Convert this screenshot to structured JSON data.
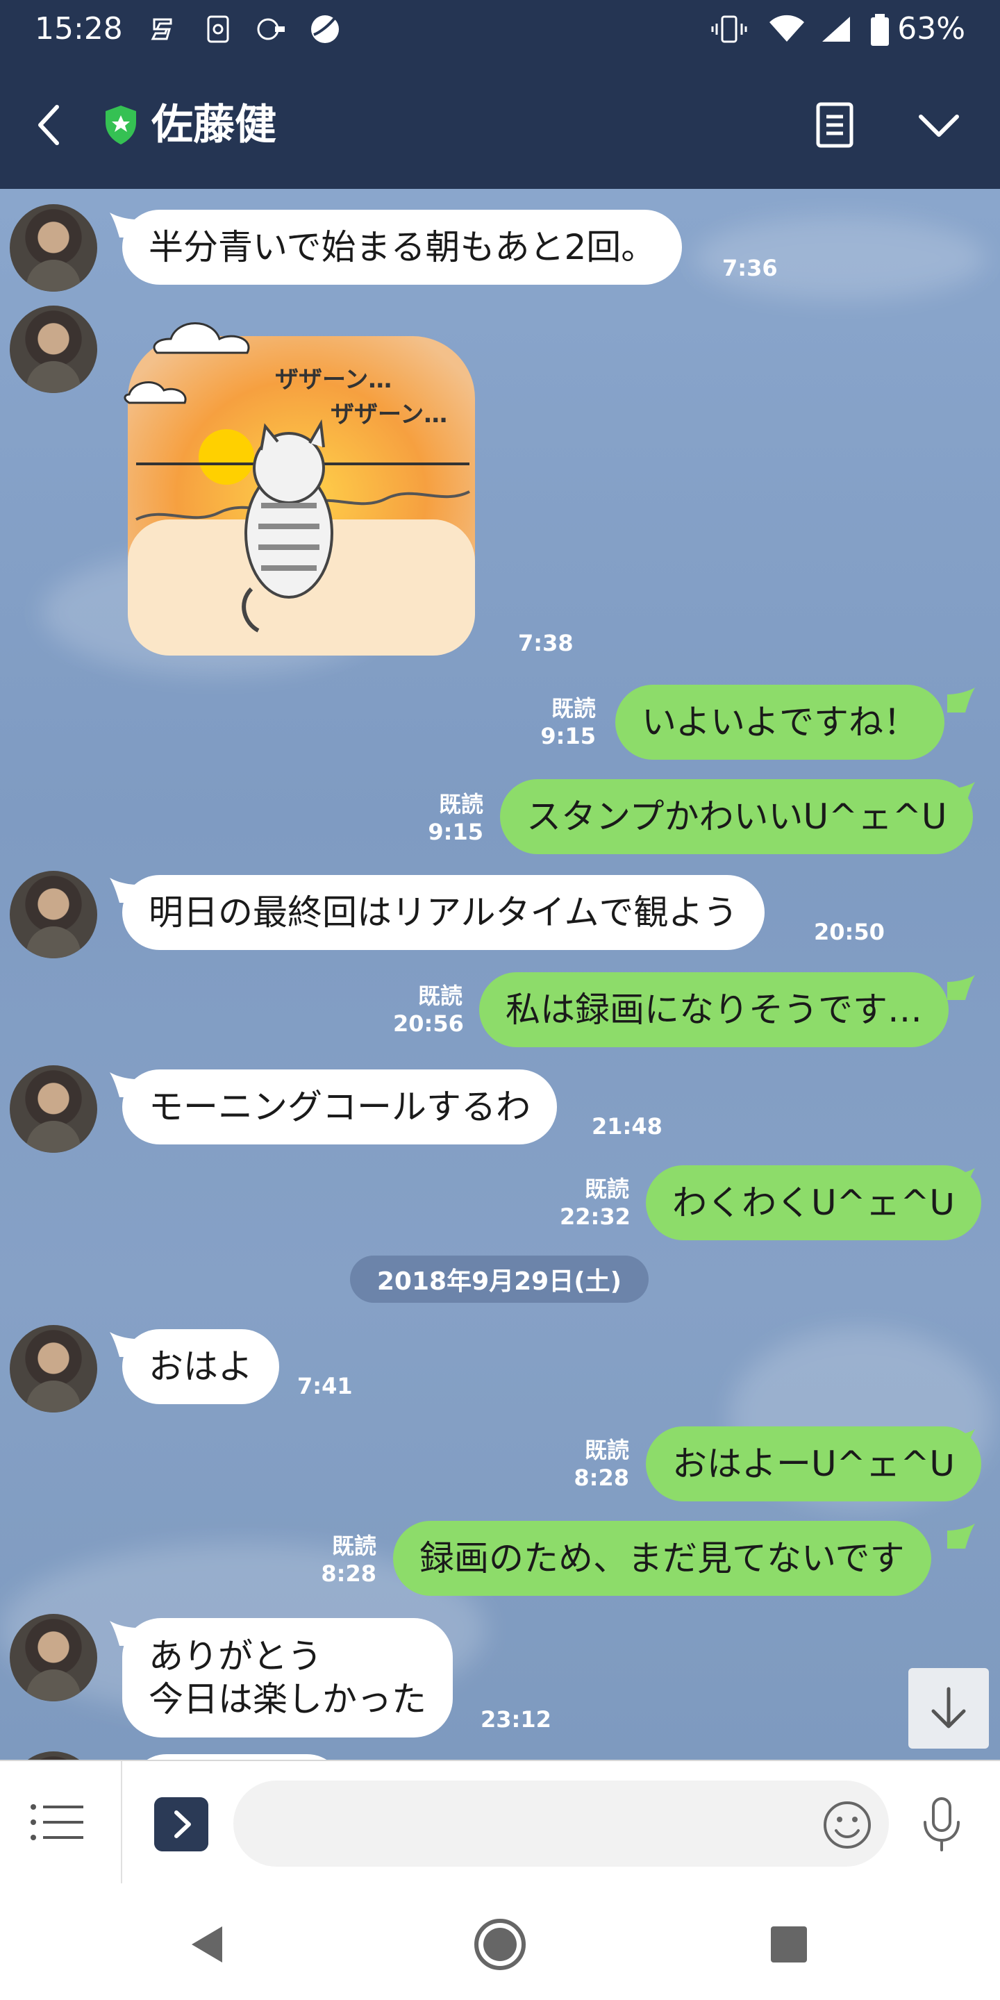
{
  "status_bar": {
    "time": "15:28",
    "battery": "63%"
  },
  "header": {
    "contact_name": "佐藤健"
  },
  "messages": {
    "m1": {
      "text": "半分青いで始まる朝もあと2回。",
      "time": "7:36"
    },
    "m2": {
      "sticker_text": "ザザーン…\nザザーン…",
      "time": "7:38"
    },
    "m3": {
      "text": "いよいよですね！",
      "read": "既読",
      "time": "9:15"
    },
    "m4": {
      "text": "スタンプかわいいU^ェ^U",
      "read": "既読",
      "time": "9:15"
    },
    "m5": {
      "text": "明日の最終回はリアルタイムで観よう",
      "time": "20:50"
    },
    "m6": {
      "text": "私は録画になりそうです…",
      "read": "既読",
      "time": "20:56"
    },
    "m7": {
      "text": "モーニングコールするわ",
      "time": "21:48"
    },
    "m8": {
      "text": "わくわくU^ェ^U",
      "read": "既読",
      "time": "22:32"
    },
    "date_separator": "2018年9月29日(土)",
    "m9": {
      "text": "おはよ",
      "time": "7:41"
    },
    "m10": {
      "text": "おはよーU^ェ^U",
      "read": "既読",
      "time": "8:28"
    },
    "m11": {
      "text": "録画のため、まだ見てないです",
      "read": "既読",
      "time": "8:28"
    },
    "m12": {
      "text": "ありがとう\n今日は楽しかった",
      "time": "23:12"
    }
  },
  "input": {
    "placeholder": ""
  },
  "colors": {
    "header_bg": "#253553",
    "chat_bg": "#7e9cc3",
    "outgoing_bubble": "#8ddc6a",
    "incoming_bubble": "#ffffff"
  },
  "icons": [
    "back-icon",
    "shield-icon",
    "notes-icon",
    "chevron-down-icon",
    "menu-icon",
    "expand-icon",
    "emoji-icon",
    "mic-icon",
    "arrow-down-icon",
    "nav-back-icon",
    "nav-home-icon",
    "nav-recents-icon"
  ]
}
